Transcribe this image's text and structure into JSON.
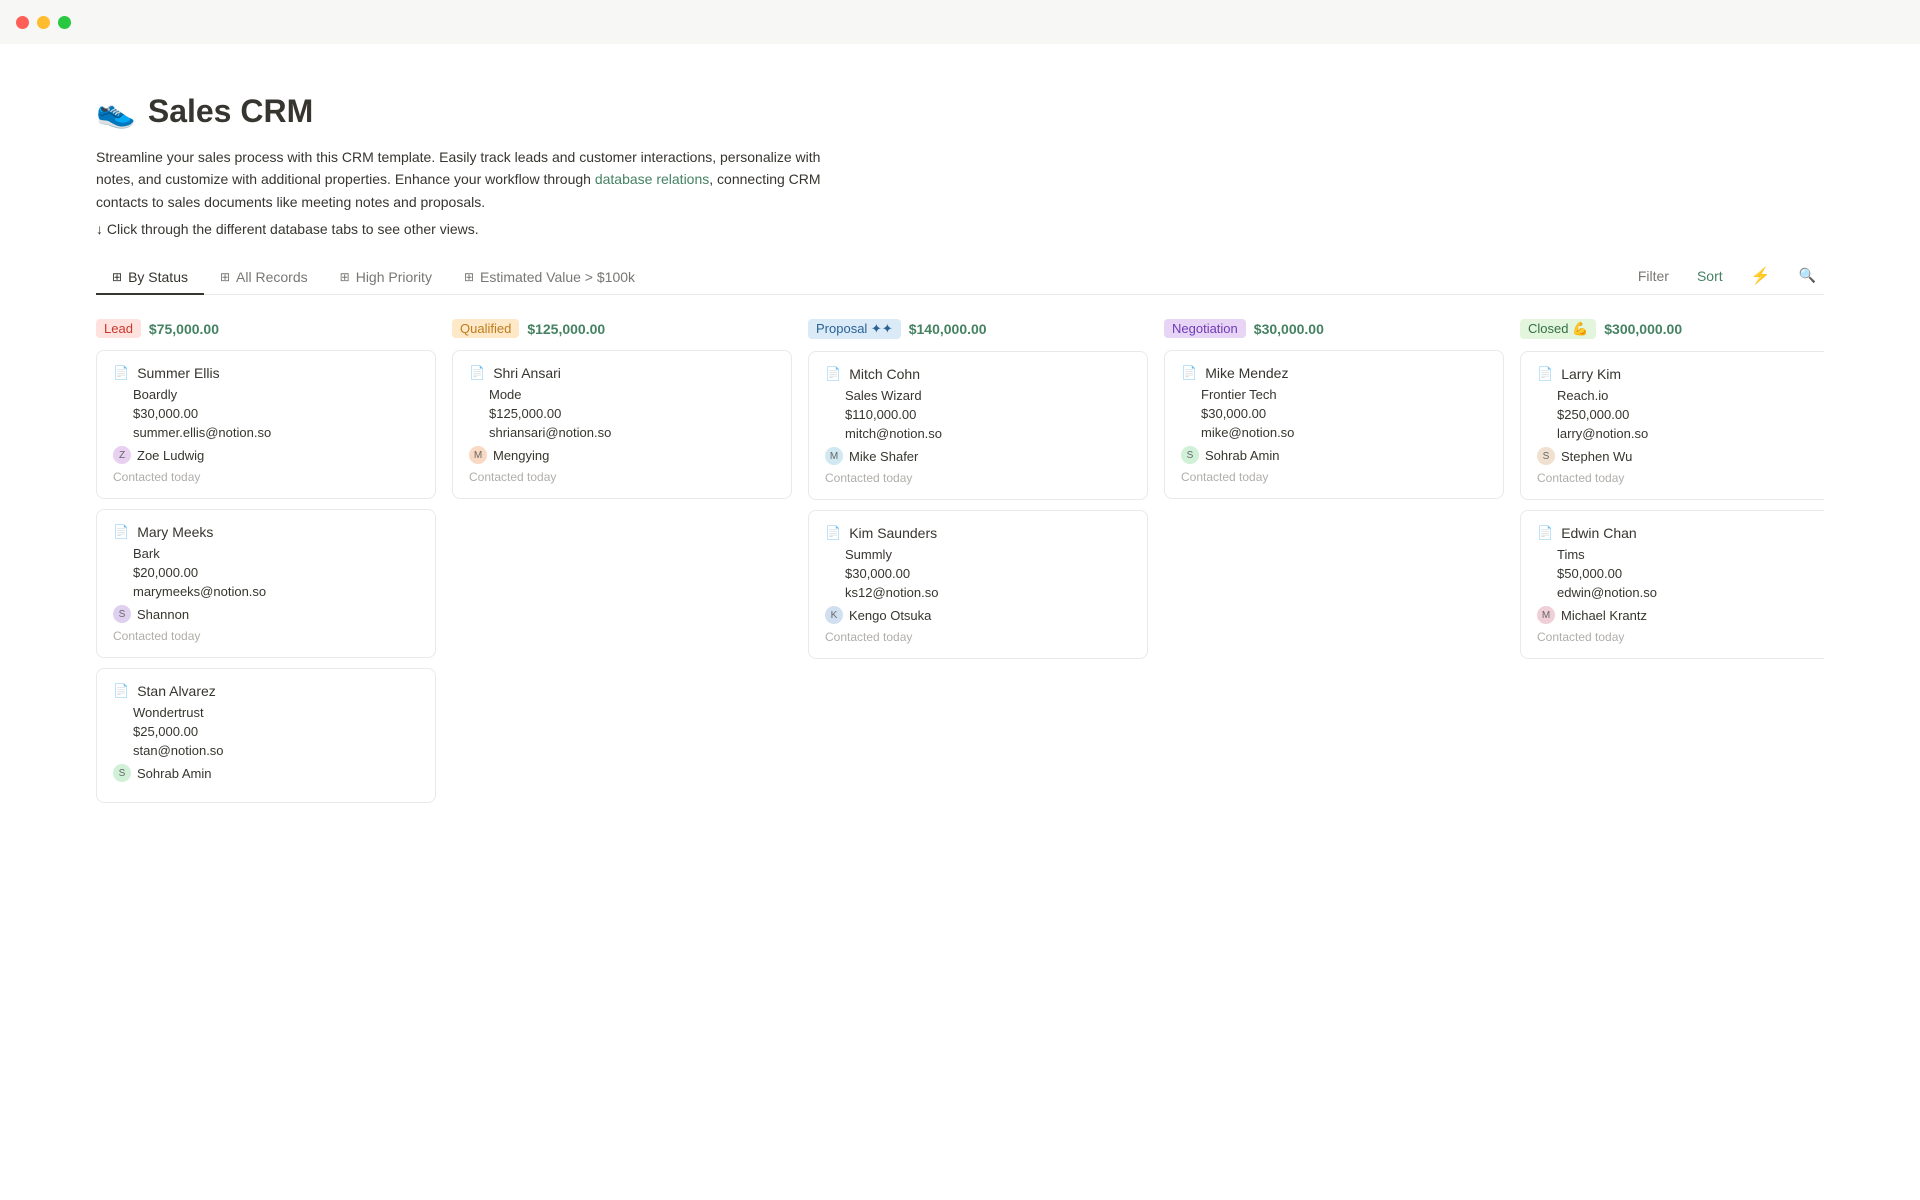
{
  "titlebar": {
    "dots": [
      "red",
      "yellow",
      "green"
    ]
  },
  "page": {
    "icon": "👟",
    "title": "Sales CRM",
    "description1": "Streamline your sales process with this CRM template. Easily track leads and customer interactions, personalize with notes, and customize with additional properties. Enhance your workflow through ",
    "description_link": "database relations",
    "description2": ", connecting CRM contacts to sales documents like meeting notes and proposals.",
    "hint": "↓ Click through the different database tabs to see other views."
  },
  "tabs": [
    {
      "id": "by-status",
      "label": "By Status",
      "icon": "⊞",
      "active": true
    },
    {
      "id": "all-records",
      "label": "All Records",
      "icon": "⊞",
      "active": false
    },
    {
      "id": "high-priority",
      "label": "High Priority",
      "icon": "⊞",
      "active": false
    },
    {
      "id": "estimated-value",
      "label": "Estimated Value > $100k",
      "icon": "⊞",
      "active": false
    }
  ],
  "toolbar": {
    "filter": "Filter",
    "sort": "Sort",
    "lightning": "⚡",
    "search": "🔍"
  },
  "columns": [
    {
      "id": "lead",
      "status_label": "Lead",
      "status_class": "status-lead",
      "total_value": "$75,000.00",
      "cards": [
        {
          "name": "Summer Ellis",
          "company": "Boardly",
          "value": "$30,000.00",
          "email": "summer.ellis@notion.so",
          "assignee": "Zoe Ludwig",
          "assignee_class": "av-zoe",
          "contacted": "Contacted today"
        },
        {
          "name": "Mary Meeks",
          "company": "Bark",
          "value": "$20,000.00",
          "email": "marymeeks@notion.so",
          "assignee": "Shannon",
          "assignee_class": "av-shannon",
          "contacted": "Contacted today"
        },
        {
          "name": "Stan Alvarez",
          "company": "Wondertrust",
          "value": "$25,000.00",
          "email": "stan@notion.so",
          "assignee": "Sohrab Amin",
          "assignee_class": "av-sohrab",
          "contacted": ""
        }
      ]
    },
    {
      "id": "qualified",
      "status_label": "Qualified",
      "status_class": "status-qualified",
      "total_value": "$125,000.00",
      "cards": [
        {
          "name": "Shri Ansari",
          "company": "Mode",
          "value": "$125,000.00",
          "email": "shriansari@notion.so",
          "assignee": "Mengying",
          "assignee_class": "av-mengying",
          "contacted": "Contacted today"
        }
      ]
    },
    {
      "id": "proposal",
      "status_label": "Proposal ✦✦",
      "status_class": "status-proposal",
      "total_value": "$140,000.00",
      "cards": [
        {
          "name": "Mitch Cohn",
          "company": "Sales Wizard",
          "value": "$110,000.00",
          "email": "mitch@notion.so",
          "assignee": "Mike Shafer",
          "assignee_class": "av-mikeshafer",
          "contacted": "Contacted today"
        },
        {
          "name": "Kim Saunders",
          "company": "Summly",
          "value": "$30,000.00",
          "email": "ks12@notion.so",
          "assignee": "Kengo Otsuka",
          "assignee_class": "av-kengo",
          "contacted": "Contacted today"
        }
      ]
    },
    {
      "id": "negotiation",
      "status_label": "Negotiation",
      "status_class": "status-negotiation",
      "total_value": "$30,000.00",
      "cards": [
        {
          "name": "Mike Mendez",
          "company": "Frontier Tech",
          "value": "$30,000.00",
          "email": "mike@notion.so",
          "assignee": "Sohrab Amin",
          "assignee_class": "av-sohrab",
          "contacted": "Contacted today"
        }
      ]
    },
    {
      "id": "closed",
      "status_label": "Closed 💪",
      "status_class": "status-closed",
      "total_value": "$300,000.00",
      "cards": [
        {
          "name": "Larry Kim",
          "company": "Reach.io",
          "value": "$250,000.00",
          "email": "larry@notion.so",
          "assignee": "Stephen Wu",
          "assignee_class": "av-stephen",
          "contacted": "Contacted today"
        },
        {
          "name": "Edwin Chan",
          "company": "Tims",
          "value": "$50,000.00",
          "email": "edwin@notion.so",
          "assignee": "Michael Krantz",
          "assignee_class": "av-michael",
          "contacted": "Contacted today"
        }
      ]
    }
  ]
}
